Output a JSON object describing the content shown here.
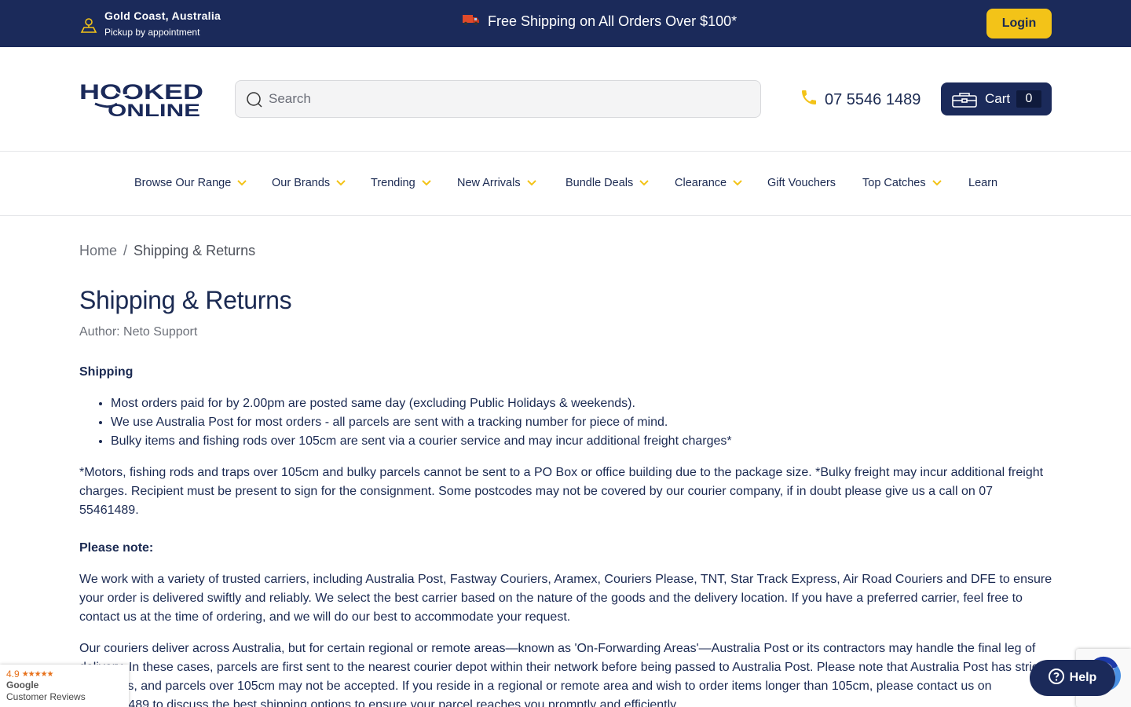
{
  "topbar": {
    "location_title": "Gold Coast, Australia",
    "location_sub": "Pickup by appointment",
    "promo": "Free Shipping on All Orders Over $100*",
    "login": "Login"
  },
  "header": {
    "logo_text": "HOOKED ONLINE",
    "search_placeholder": "Search",
    "phone": "07 5546 1489",
    "cart_label": "Cart",
    "cart_count": "0"
  },
  "nav": [
    {
      "label": "Browse Our Range",
      "dropdown": true
    },
    {
      "label": "Our Brands",
      "dropdown": true
    },
    {
      "label": "Trending",
      "dropdown": true
    },
    {
      "label": "New Arrivals",
      "dropdown": true
    },
    {
      "label": "Bundle Deals",
      "dropdown": true
    },
    {
      "label": "Clearance",
      "dropdown": true
    },
    {
      "label": "Gift Vouchers",
      "dropdown": false
    },
    {
      "label": "Top Catches",
      "dropdown": true
    },
    {
      "label": "Learn",
      "dropdown": false
    }
  ],
  "breadcrumb": {
    "home": "Home",
    "separator": "/",
    "current": "Shipping & Returns"
  },
  "page": {
    "title": "Shipping & Returns",
    "author": "Author: Neto Support"
  },
  "content": {
    "shipping_heading": "Shipping",
    "shipping_items": [
      "Most orders paid for by 2.00pm are posted same day (excluding Public Holidays & weekends).",
      "We use Australia Post for most orders - all parcels are sent with a tracking number for piece of mind.",
      "Bulky items and fishing rods over 105cm are sent via a courier service and may incur additional freight charges*"
    ],
    "shipping_note": "*Motors, fishing rods and traps over 105cm and bulky parcels cannot be sent to a PO Box or office building due to the package size. *Bulky freight may incur additional freight charges. Recipient must be present to sign for the consignment. Some postcodes may not be covered by our courier company, if in doubt please give us a call on 07 55461489.",
    "please_note_heading": "Please note:",
    "carriers_paragraph": "We work with a variety of trusted carriers, including Australia Post, Fastway Couriers, Aramex, Couriers Please, TNT, Star Track Express, Air Road Couriers and DFE to ensure your order is delivered swiftly and reliably. We select the best carrier based on the nature of the goods and the delivery location. If you have a preferred carrier, feel free to contact us at the time of ordering, and we will do our best to accommodate your request.",
    "forwarding_paragraph": "Our couriers deliver across Australia, but for certain regional or remote areas—known as 'On-Forwarding Areas'—Australia Post or its contractors may handle the final leg of delivery. In these cases, parcels are first sent to the nearest courier depot within their network before being passed to Australia Post. Please note that Australia Post has stricter size limits, and parcels over 105cm may not be accepted. If you reside in a regional or remote area and wish to order items longer than 105cm, please contact us on 0755461489 to discuss the best shipping options to ensure your parcel reaches you promptly and efficiently."
  },
  "google_badge": {
    "rating": "4.9",
    "stars": "★★★★★",
    "name": "Google",
    "sub": "Customer Reviews"
  },
  "help": {
    "label": "Help"
  },
  "colors": {
    "navy": "#1b2a5a",
    "accent_yellow": "#f3c318",
    "text": "#1b2a52",
    "muted": "#6d717a"
  }
}
